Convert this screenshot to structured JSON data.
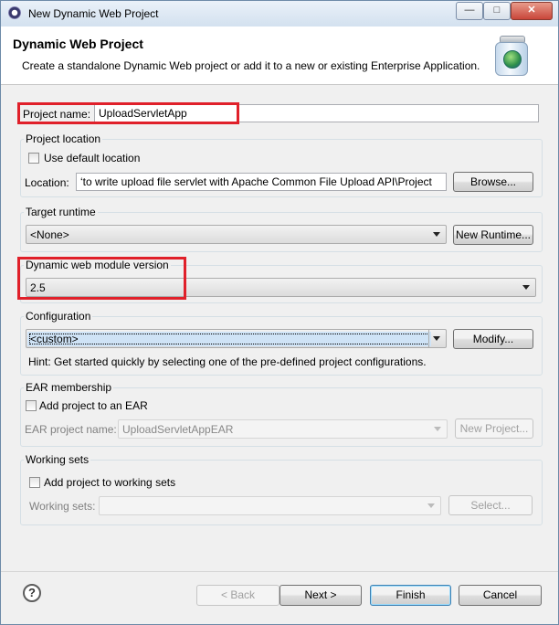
{
  "window": {
    "title": "New Dynamic Web Project",
    "controls": [
      "—",
      "□",
      "✕"
    ]
  },
  "banner": {
    "title": "Dynamic Web Project",
    "description": "Create a standalone Dynamic Web project or add it to a new or existing Enterprise Application."
  },
  "project_name": {
    "label": "Project name:",
    "value": "UploadServletApp"
  },
  "project_location": {
    "group_title": "Project location",
    "use_default_label": "Use default location",
    "use_default_checked": false,
    "location_label": "Location:",
    "location_value": "‘to write upload file servlet with Apache Common File Upload API\\Project",
    "browse_label": "Browse..."
  },
  "target_runtime": {
    "group_title": "Target runtime",
    "selected": "<None>",
    "new_runtime_label": "New Runtime..."
  },
  "module_version": {
    "group_title": "Dynamic web module version",
    "selected": "2.5"
  },
  "configuration": {
    "group_title": "Configuration",
    "selected": "<custom>",
    "modify_label": "Modify...",
    "hint": "Hint: Get started quickly by selecting one of the pre-defined project configurations."
  },
  "ear": {
    "group_title": "EAR membership",
    "add_label": "Add project to an EAR",
    "add_checked": false,
    "project_name_label": "EAR project name:",
    "project_name_value": "UploadServletAppEAR",
    "new_project_label": "New Project..."
  },
  "working_sets": {
    "group_title": "Working sets",
    "add_label": "Add project to working sets",
    "add_checked": false,
    "sets_label": "Working sets:",
    "sets_value": "",
    "select_label": "Select..."
  },
  "footer": {
    "help_glyph": "?",
    "back_label": "< Back",
    "next_label": "Next >",
    "finish_label": "Finish",
    "cancel_label": "Cancel"
  },
  "colors": {
    "highlight_box": "#e0202a",
    "default_button": "#3c7fb1"
  }
}
